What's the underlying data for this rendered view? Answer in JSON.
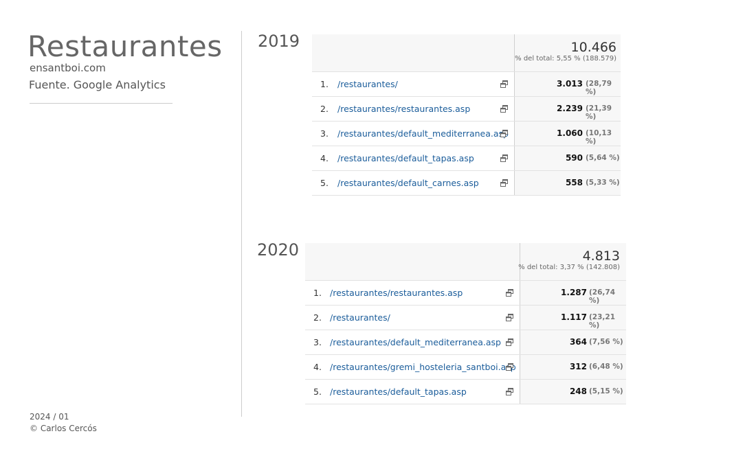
{
  "header": {
    "title": "Restaurantes",
    "site": "ensantboi.com",
    "source": "Fuente. Google Analytics"
  },
  "footer": {
    "date": "2024 / 01",
    "copyright": "© Carlos Cercós"
  },
  "colors": {
    "link": "#1a5c9a",
    "header_bg": "#f7f7f7",
    "text_muted": "#666666"
  },
  "report_2019": {
    "year": "2019",
    "total": "10.466",
    "total_pct": "% del total: 5,55 % (188.579)",
    "rows": [
      {
        "rank": "1.",
        "page": "/restaurantes/",
        "value": "3.013",
        "pct": "(28,79 %)"
      },
      {
        "rank": "2.",
        "page": "/restaurantes/restaurantes.asp",
        "value": "2.239",
        "pct": "(21,39 %)"
      },
      {
        "rank": "3.",
        "page": "/restaurantes/default_mediterranea.asp",
        "value": "1.060",
        "pct": "(10,13 %)"
      },
      {
        "rank": "4.",
        "page": "/restaurantes/default_tapas.asp",
        "value": "590",
        "pct": "(5,64 %)"
      },
      {
        "rank": "5.",
        "page": "/restaurantes/default_carnes.asp",
        "value": "558",
        "pct": "(5,33 %)"
      }
    ]
  },
  "report_2020": {
    "year": "2020",
    "total": "4.813",
    "total_pct": "% del total: 3,37 % (142.808)",
    "rows": [
      {
        "rank": "1.",
        "page": "/restaurantes/restaurantes.asp",
        "value": "1.287",
        "pct": "(26,74 %)"
      },
      {
        "rank": "2.",
        "page": "/restaurantes/",
        "value": "1.117",
        "pct": "(23,21 %)"
      },
      {
        "rank": "3.",
        "page": "/restaurantes/default_mediterranea.asp",
        "value": "364",
        "pct": "(7,56 %)"
      },
      {
        "rank": "4.",
        "page": "/restaurantes/gremi_hosteleria_santboi.asp",
        "value": "312",
        "pct": "(6,48 %)"
      },
      {
        "rank": "5.",
        "page": "/restaurantes/default_tapas.asp",
        "value": "248",
        "pct": "(5,15 %)"
      }
    ]
  },
  "icons": {
    "row_action": "open-in-new-window-icon"
  }
}
